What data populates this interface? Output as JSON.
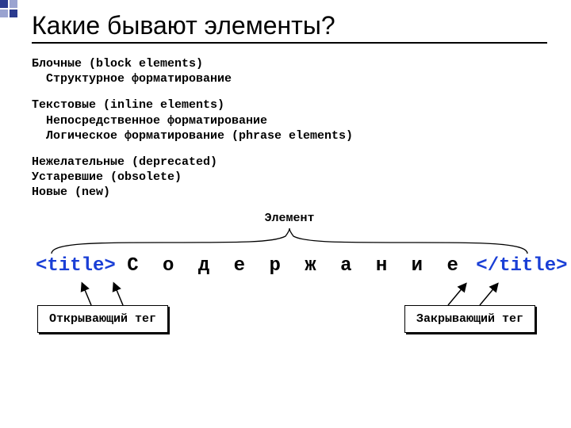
{
  "title": "Какие бывают элементы?",
  "group1": {
    "heading": "Блочные (block elements)",
    "sub1": "Структурное форматирование"
  },
  "group2": {
    "heading": "Текстовые (inline elements)",
    "sub1": "Непосредственное форматирование",
    "sub2": "Логическое форматирование (phrase elements)"
  },
  "group3": {
    "l1": "Нежелательные (deprecated)",
    "l2": "Устаревшие (obsolete)",
    "l3": "Новые (new)"
  },
  "element_label": "Элемент",
  "example": {
    "open_tag": "<title>",
    "content": "С о д е р ж а н и е",
    "close_tag": "</title>"
  },
  "box_open": "Открывающий тег",
  "box_close": "Закрывающий тег"
}
